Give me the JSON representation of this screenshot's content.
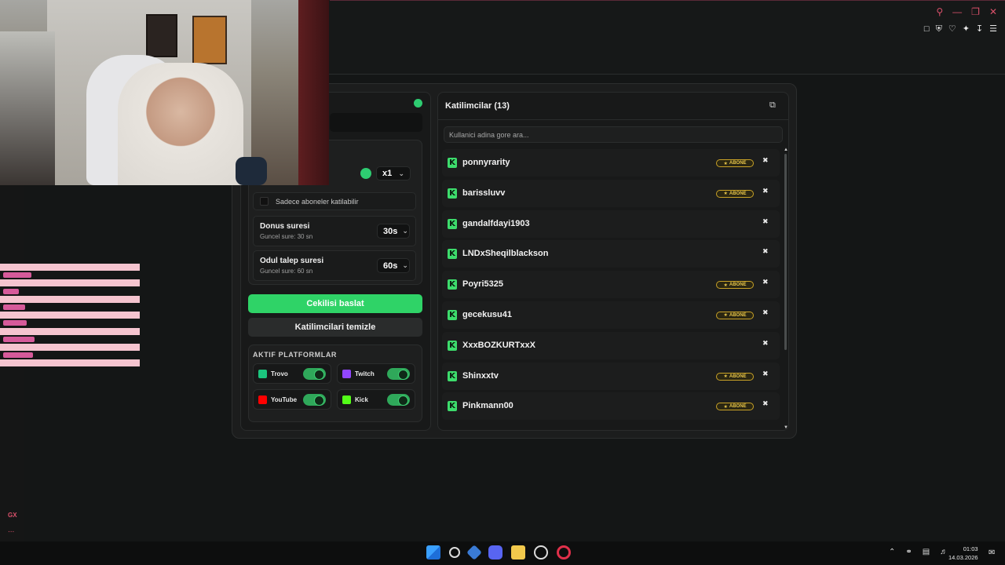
{
  "browser": {
    "top_icons": [
      "search-icon",
      "minimize-icon",
      "restore-icon",
      "close-icon"
    ],
    "toolbar_icons": [
      "snapshot-icon",
      "shield-icon",
      "heart-icon",
      "extensions-icon",
      "download-icon",
      "menu-icon"
    ],
    "accent": "#d9506a",
    "sidebar_gx": "GX",
    "sidebar_more": "..."
  },
  "giveaway": {
    "status_color": "#2ecc71",
    "multiplier": {
      "value": "x1"
    },
    "subscribers_only": {
      "label": "Sadece aboneler katilabilir",
      "checked": false
    },
    "turn_duration": {
      "title": "Donus suresi",
      "sub": "Guncel sure: 30 sn",
      "value": "30s"
    },
    "claim_duration": {
      "title": "Odul talep suresi",
      "sub": "Guncel sure: 60 sn",
      "value": "60s"
    },
    "start_button": "Cekilisi baslat",
    "clear_button": "Katilimcilari temizle",
    "platforms": {
      "title": "AKTIF PLATFORMLAR",
      "items": [
        {
          "name": "Trovo",
          "icon": "trovo-icon",
          "color": "#1bc47d",
          "enabled": true
        },
        {
          "name": "Twitch",
          "icon": "twitch-icon",
          "color": "#9146ff",
          "enabled": true
        },
        {
          "name": "YouTube",
          "icon": "youtube-icon",
          "color": "#ff0000",
          "enabled": true
        },
        {
          "name": "Kick",
          "icon": "kick-icon",
          "color": "#53fc18",
          "enabled": true
        }
      ]
    }
  },
  "participants": {
    "title": "Katilimcilar (13)",
    "search_placeholder": "Kullanici adina gore ara...",
    "badge_label": "ABONE",
    "items": [
      {
        "name": "ponnyrarity",
        "subscriber": true
      },
      {
        "name": "barissluvv",
        "subscriber": true
      },
      {
        "name": "gandalfdayi1903",
        "subscriber": false
      },
      {
        "name": "LNDxSheqilblackson",
        "subscriber": false
      },
      {
        "name": "Poyri5325",
        "subscriber": true
      },
      {
        "name": "gecekusu41",
        "subscriber": true
      },
      {
        "name": "XxxBOZKURTxxX",
        "subscriber": false
      },
      {
        "name": "Shinxxtv",
        "subscriber": true
      },
      {
        "name": "Pinkmann00",
        "subscriber": true
      }
    ]
  },
  "taskbar": {
    "apps": [
      "windows-start-icon",
      "search-icon",
      "app-icon",
      "discord-icon",
      "file-explorer-icon",
      "app-icon",
      "opera-gx-icon"
    ],
    "time": "01:03",
    "date": "14.03.2026"
  }
}
